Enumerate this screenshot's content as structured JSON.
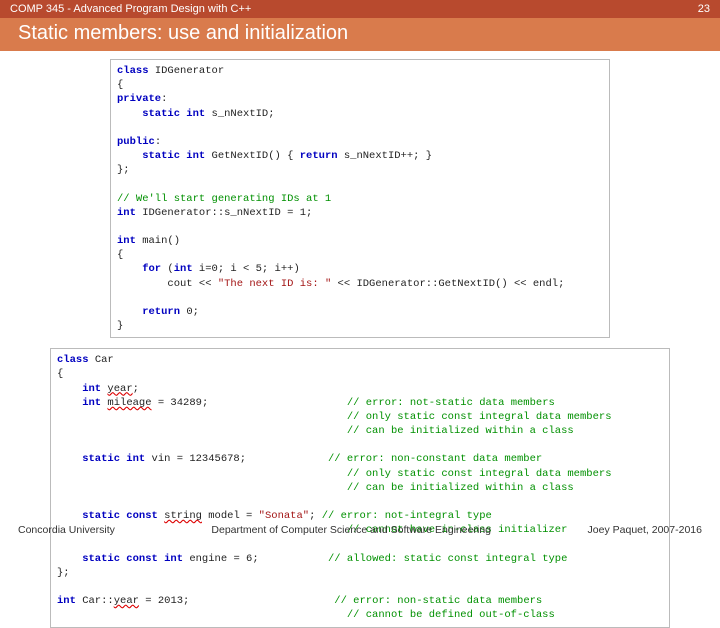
{
  "header": {
    "course": "COMP 345 - Advanced Program Design with C++",
    "page_number": "23"
  },
  "title": "Static members: use and initialization",
  "footer": {
    "left": "Concordia University",
    "center": "Department of Computer Science and Software Engineering",
    "right": "Joey Paquet, 2007-2016"
  },
  "code_top": {
    "l1a": "class",
    "l1b": " IDGenerator",
    "l2": "{",
    "l3a": "private",
    "l3b": ":",
    "l4a": "    static int",
    "l4b": " s_nNextID;",
    "l5": "",
    "l6a": "public",
    "l6b": ":",
    "l7a": "    static int",
    "l7b": " GetNextID() { ",
    "l7c": "return",
    "l7d": " s_nNextID++; }",
    "l8": "};",
    "l9": "",
    "l10": "// We'll start generating IDs at 1",
    "l11a": "int",
    "l11b": " IDGenerator::s_nNextID = 1;",
    "l12": "",
    "l13a": "int",
    "l13b": " main()",
    "l14": "{",
    "l15a": "    for",
    "l15b": " (",
    "l15c": "int",
    "l15d": " i=0; i < 5; i++)",
    "l16a": "        cout << ",
    "l16b": "\"The next ID is: \"",
    "l16c": " << IDGenerator::GetNextID() << endl;",
    "l17": "",
    "l18a": "    return",
    "l18b": " 0;",
    "l19": "}"
  },
  "code_bot": {
    "l1a": "class",
    "l1b": " Car",
    "l2": "{",
    "l3a": "    int",
    "l3b": " ",
    "l3c": "year",
    "l3d": ";",
    "l4a": "    int",
    "l4b": " ",
    "l4c": "mileage",
    "l4d": " = 34289;",
    "l4e": "                      // error: not-static data members",
    "l4f": "                                              // only static const integral data members",
    "l4g": "                                              // can be initialized within a class",
    "l5": "",
    "l6a": "    static int",
    "l6b": " vin = 12345678;",
    "l6c": "             // error: non-constant data member",
    "l6d": "                                              // only static const integral data members",
    "l6e": "                                              // can be initialized within a class",
    "l7": "",
    "l8a": "    static const",
    "l8b": " ",
    "l8c": "string",
    "l8d": " model = ",
    "l8e": "\"Sonata\"",
    "l8f": ";",
    "l8g": " // error: not-integral type",
    "l8h": "                                              // cannot have in-class initializer",
    "l9": "",
    "l10a": "    static const int",
    "l10b": " engine = 6;",
    "l10c": "           // allowed: static const integral type",
    "l11": "};",
    "l12": "",
    "l13a": "int",
    "l13b": " Car::",
    "l13c": "year",
    "l13d": " = 2013;",
    "l13e": "                       // error: non-static data members",
    "l13f": "                                              // cannot be defined out-of-class"
  }
}
